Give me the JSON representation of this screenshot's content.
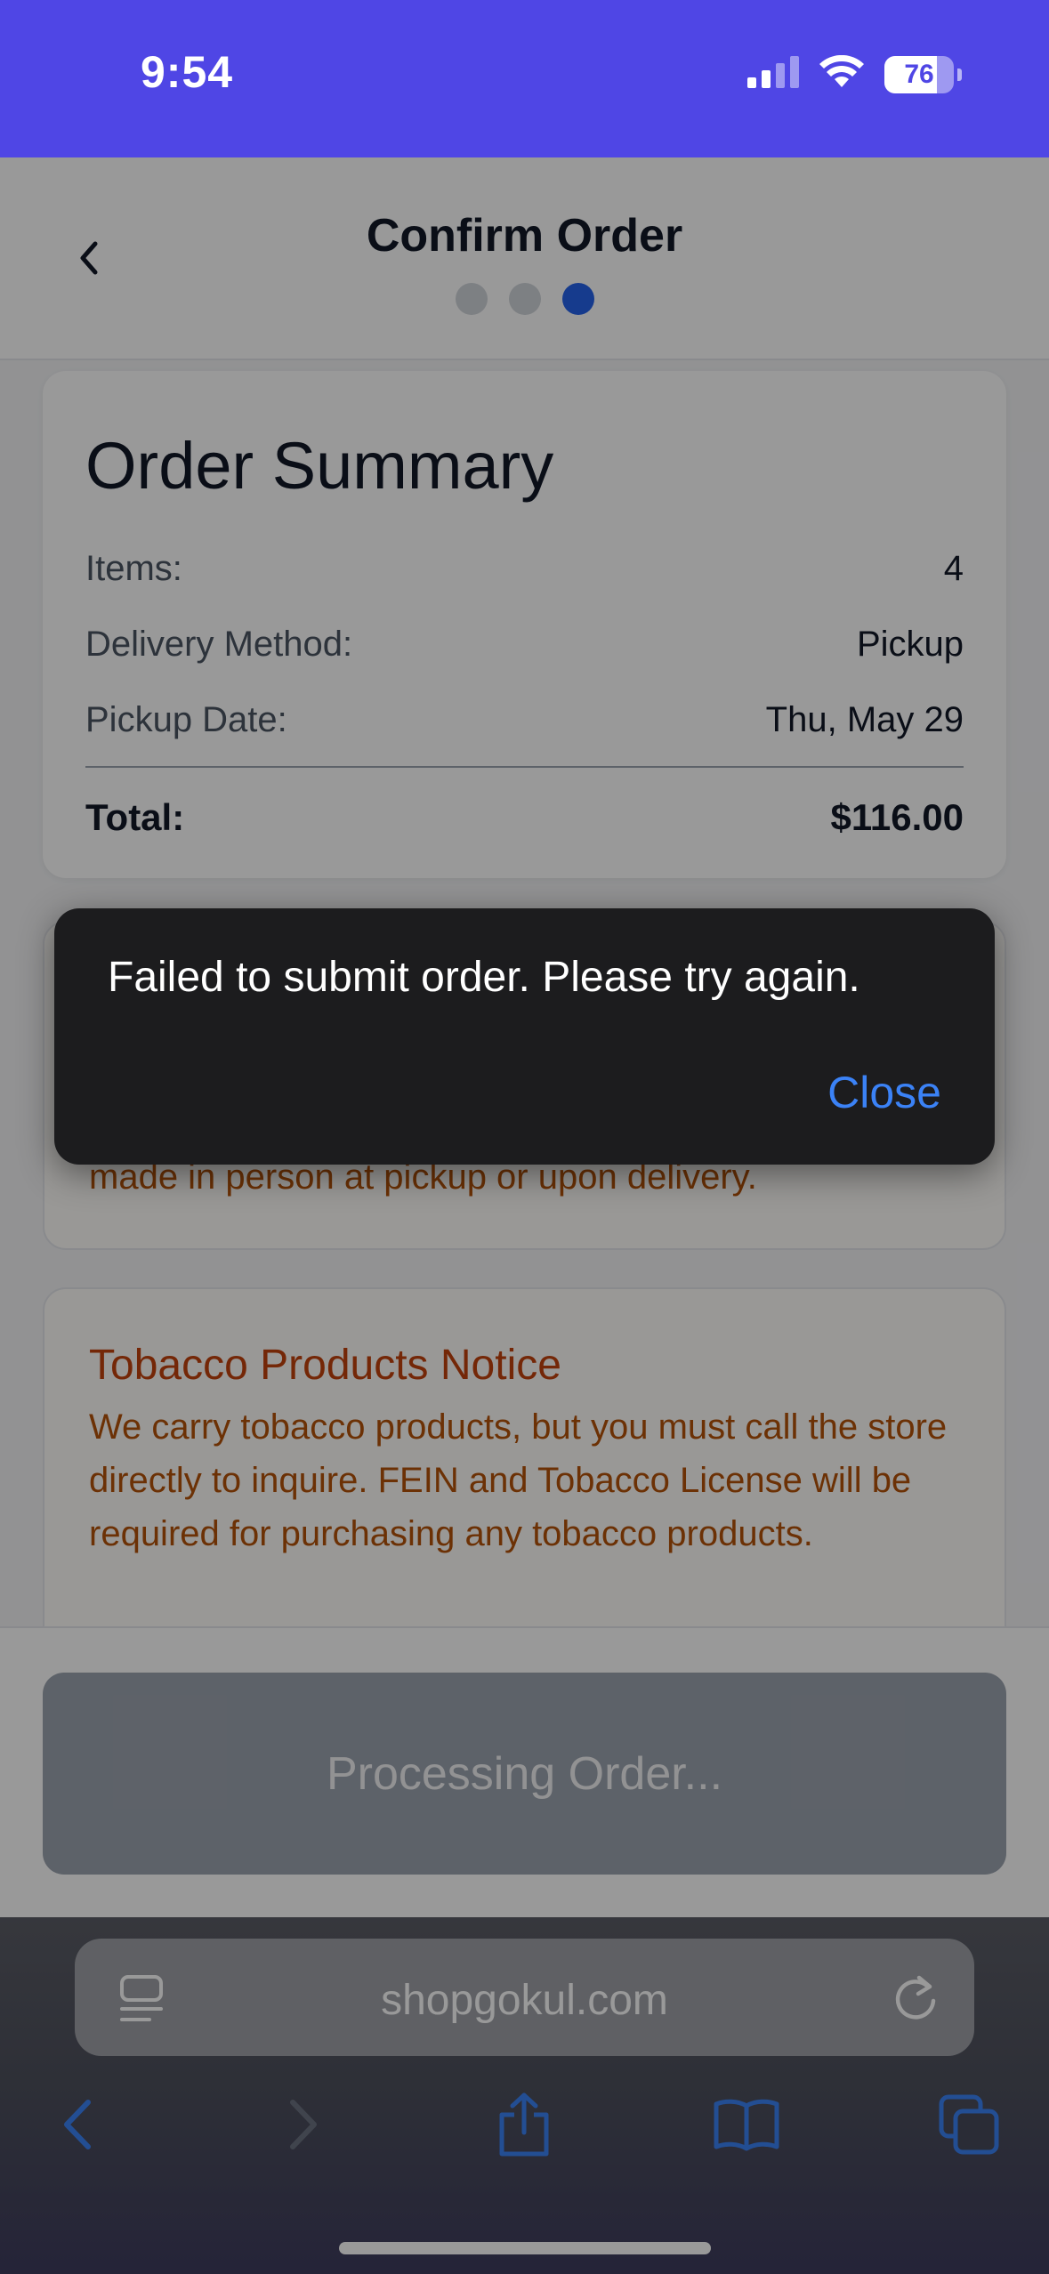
{
  "status_bar": {
    "time": "9:54",
    "battery_level": "76",
    "battery_fraction": 0.76,
    "signal_bars": 2,
    "icons": [
      "cellular-signal-icon",
      "wifi-icon",
      "battery-icon"
    ]
  },
  "header": {
    "title": "Confirm Order",
    "back_icon": "chevron-left-icon",
    "steps": {
      "total": 3,
      "current": 3
    }
  },
  "summary": {
    "title": "Order Summary",
    "items_label": "Items:",
    "items_value": "4",
    "delivery_label": "Delivery Method:",
    "delivery_value": "Pickup",
    "pickup_date_label": "Pickup Date:",
    "pickup_date_value": "Thu, May 29",
    "total_label": "Total:",
    "total_value": "$116.00"
  },
  "payment_notice": {
    "text": "made in person at pickup or upon delivery."
  },
  "tobacco_notice": {
    "title": "Tobacco Products Notice",
    "text": "We carry tobacco products, but you must call the store directly to inquire. FEIN and Tobacco License will be required for purchasing any tobacco products."
  },
  "submit_button": {
    "label": "Processing Order..."
  },
  "browser": {
    "url": "shopgokul.com",
    "icons": [
      "reader-mode-icon",
      "reload-icon",
      "back-arrow-icon",
      "forward-arrow-icon",
      "share-icon",
      "bookmarks-icon",
      "tabs-icon"
    ]
  },
  "toast": {
    "message": "Failed to submit order. Please try again.",
    "close_label": "Close"
  },
  "colors": {
    "accent": "#4f46e5",
    "step_active": "#2563eb",
    "notice_text": "#b45309",
    "toast_bg": "#1c1c1e",
    "toast_action": "#3b82f6"
  }
}
